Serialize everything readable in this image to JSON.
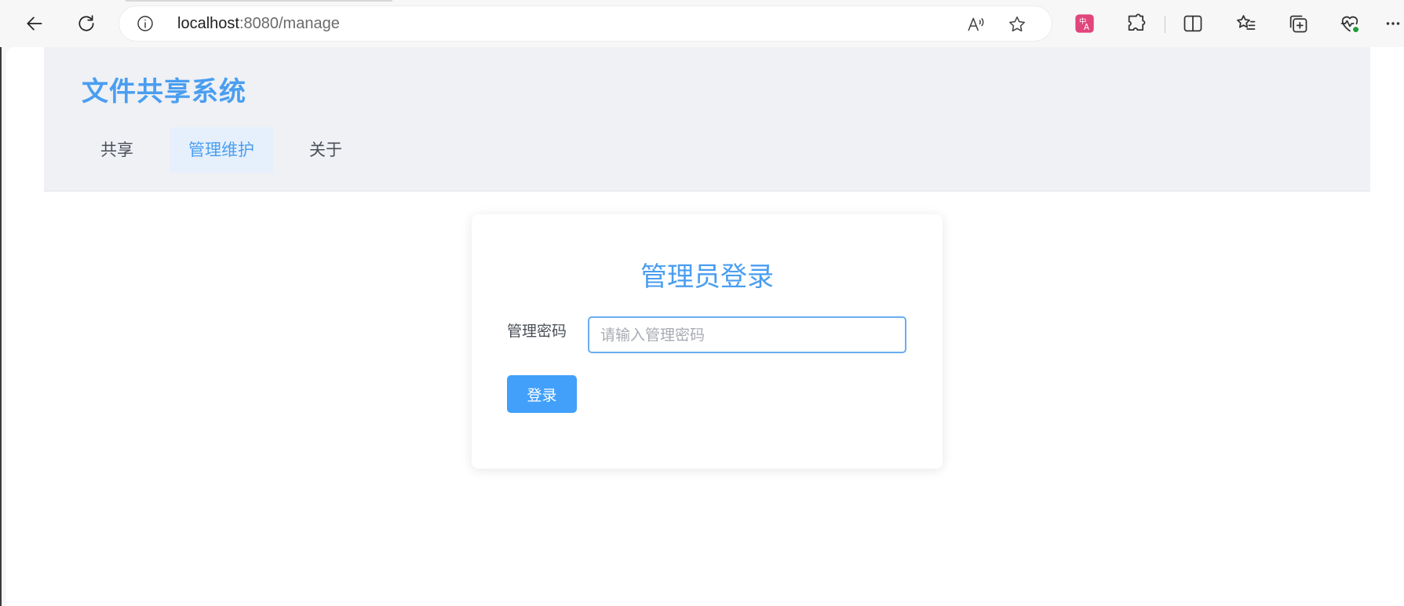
{
  "browser": {
    "url_host": "localhost",
    "url_path": ":8080/manage",
    "icons": {
      "back": "arrow-left-icon",
      "reload": "reload-icon",
      "info": "info-icon",
      "read_aloud": "read-aloud-icon",
      "favorite": "star-icon",
      "translate": "translate-icon",
      "extensions": "puzzle-icon",
      "split_screen": "split-screen-icon",
      "favorites": "favorites-list-icon",
      "collections": "collections-icon",
      "browser_essentials": "heart-pulse-icon",
      "more": "more-icon"
    },
    "colors": {
      "translate_badge": "#e0457b",
      "health_badge": "#1f9e3a"
    }
  },
  "site": {
    "title": "文件共享系统",
    "nav": [
      {
        "label": "共享",
        "active": false
      },
      {
        "label": "管理维护",
        "active": true
      },
      {
        "label": "关于",
        "active": false
      }
    ]
  },
  "login": {
    "title": "管理员登录",
    "password_label": "管理密码",
    "password_placeholder": "请输入管理密码",
    "password_value": "",
    "submit_label": "登录"
  },
  "colors": {
    "accent": "#4a9ef0",
    "button": "#42a0fb",
    "header_bg": "#eff1f5",
    "active_nav_bg": "#e6f0fc"
  }
}
